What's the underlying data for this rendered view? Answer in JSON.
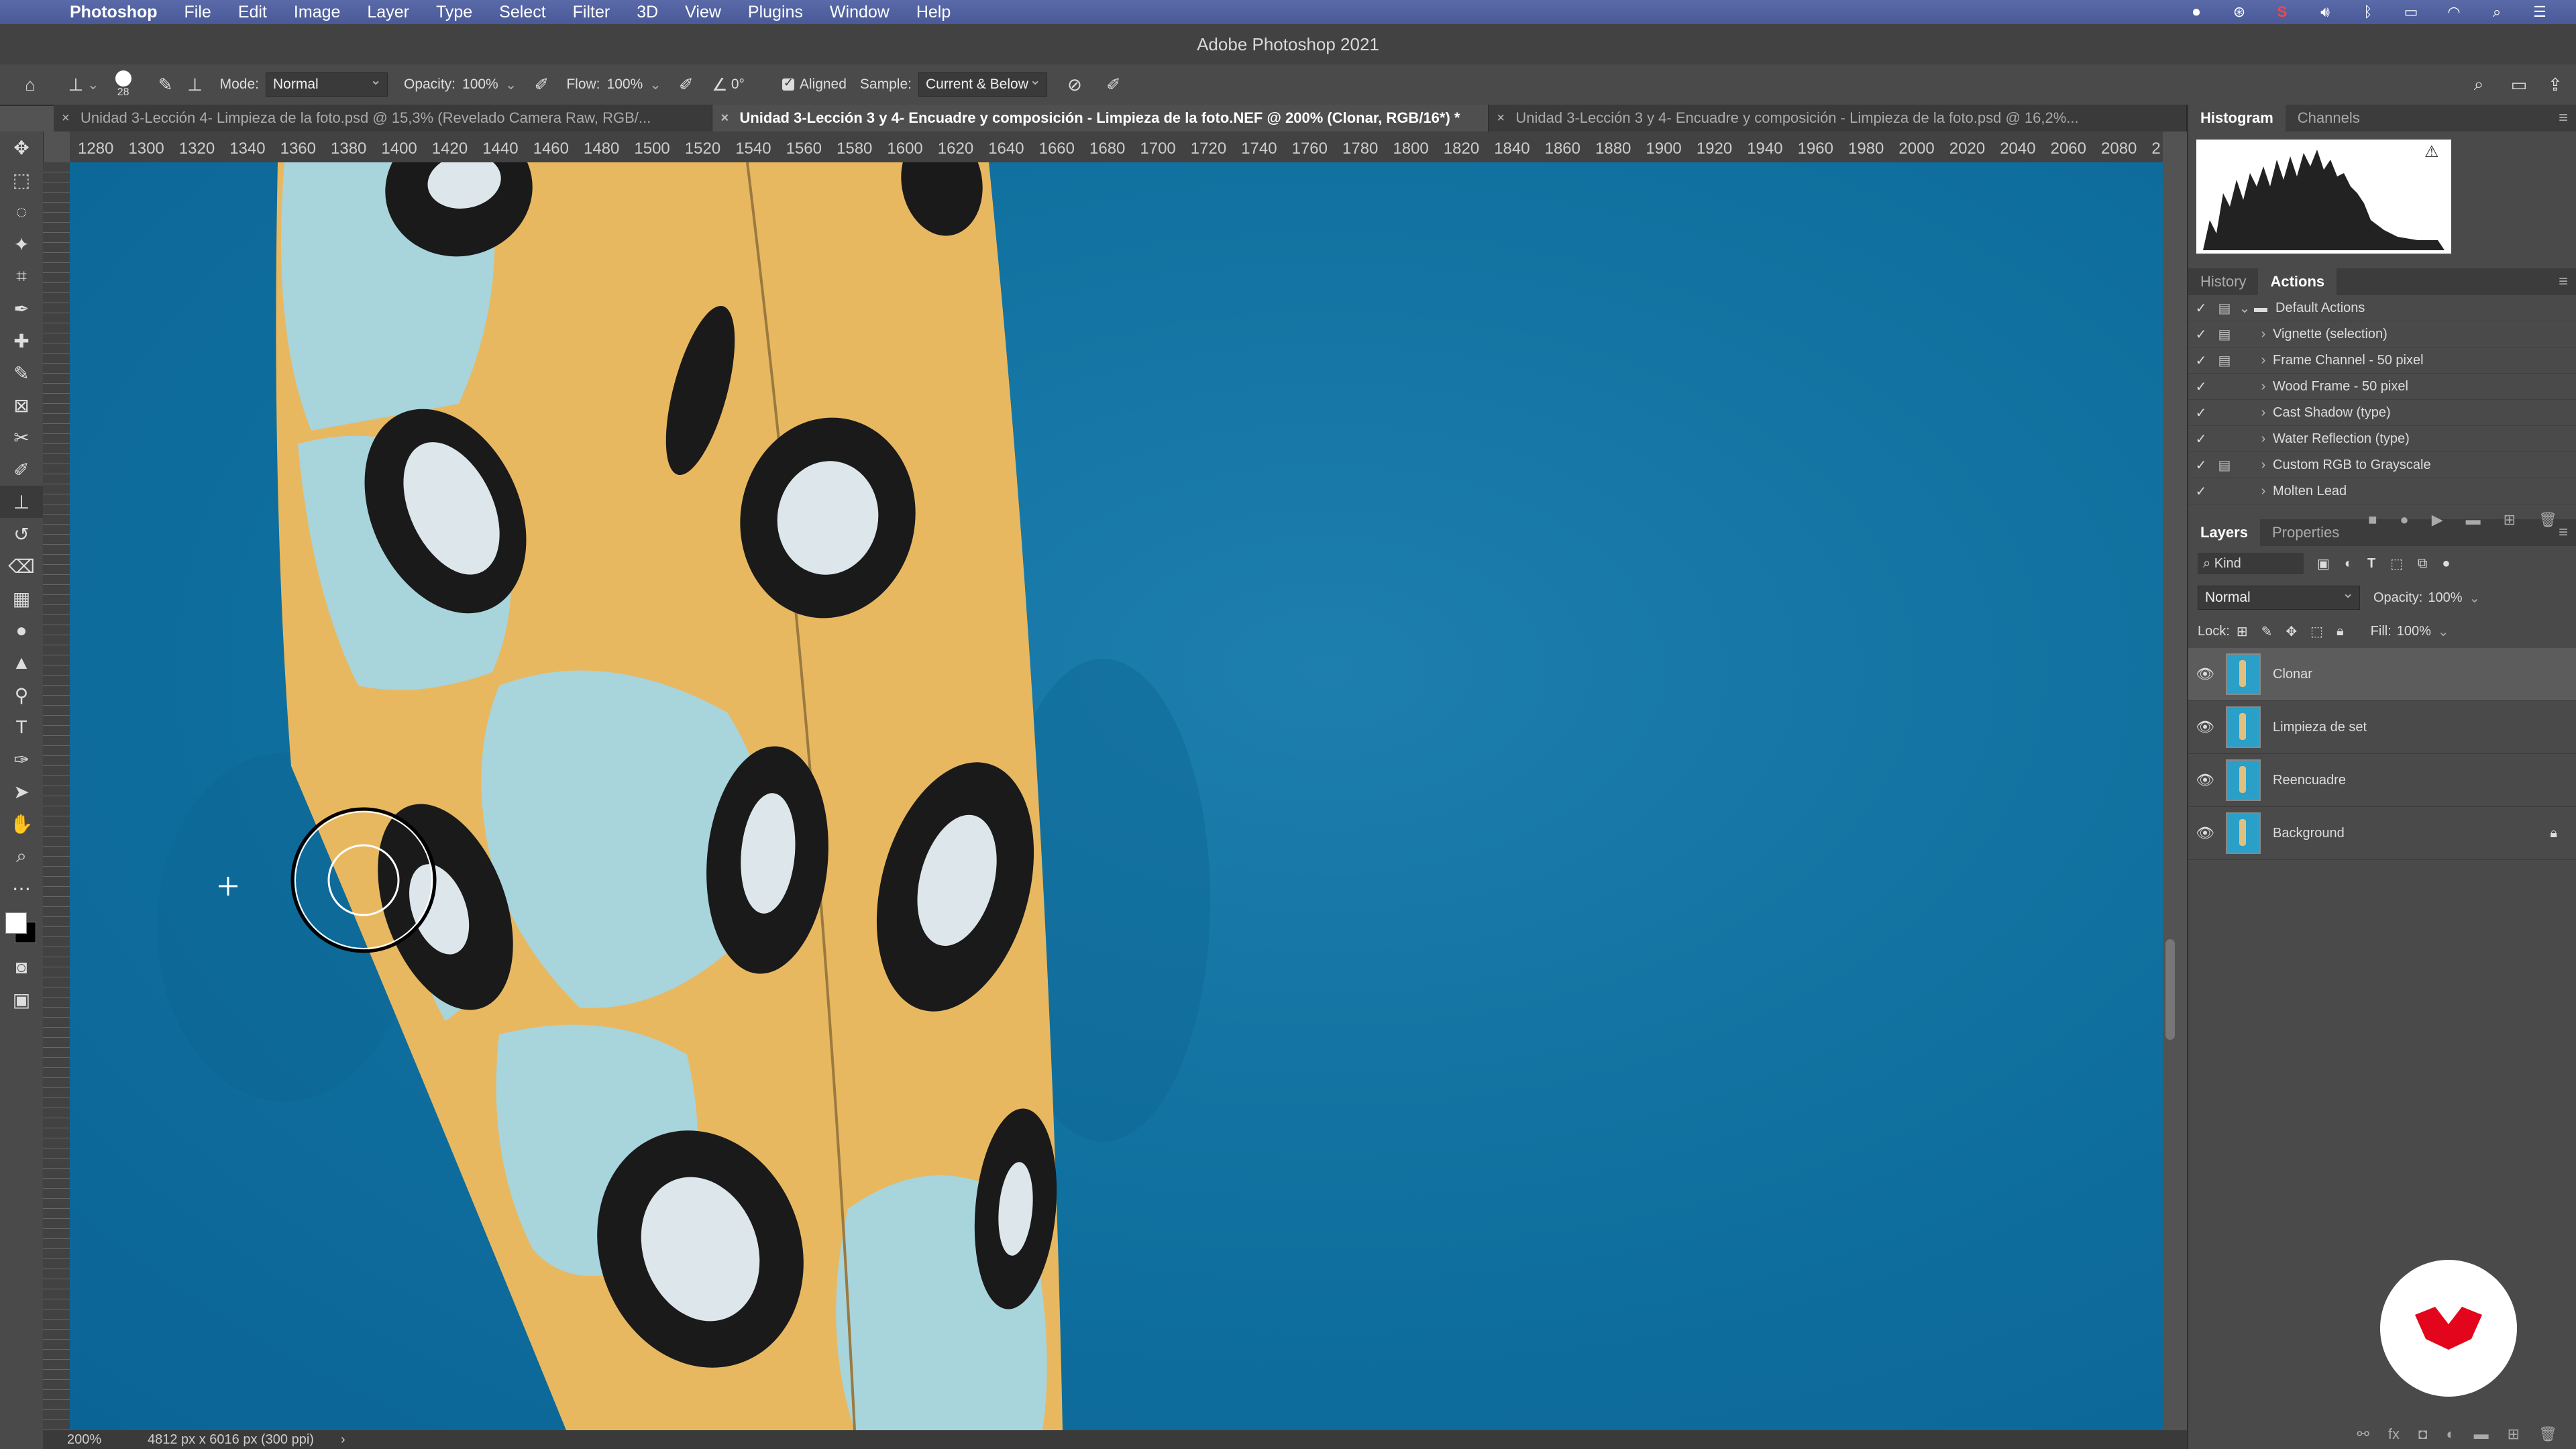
{
  "menubar": {
    "app": "Photoshop",
    "items": [
      "File",
      "Edit",
      "Image",
      "Layer",
      "Type",
      "Select",
      "Filter",
      "3D",
      "View",
      "Plugins",
      "Window",
      "Help"
    ]
  },
  "window_title": "Adobe Photoshop 2021",
  "options": {
    "brush_size": "28",
    "mode_label": "Mode:",
    "mode_value": "Normal",
    "opacity_label": "Opacity:",
    "opacity_value": "100%",
    "flow_label": "Flow:",
    "flow_value": "100%",
    "angle_value": "0°",
    "aligned_label": "Aligned",
    "sample_label": "Sample:",
    "sample_value": "Current & Below"
  },
  "tabs": [
    {
      "label": "Unidad 3-Lección 4- Limpieza de la foto.psd @ 15,3% (Revelado Camera Raw, RGB/...",
      "active": false
    },
    {
      "label": "Unidad 3-Lección 3 y 4- Encuadre y composición - Limpieza de la foto.NEF @ 200% (Clonar, RGB/16*) *",
      "active": true
    },
    {
      "label": "Unidad 3-Lección 3 y 4- Encuadre y composición - Limpieza de la foto.psd @ 16,2%...",
      "active": false
    }
  ],
  "ruler_ticks": [
    "1280",
    "1300",
    "1320",
    "1340",
    "1360",
    "1380",
    "1400",
    "1420",
    "1440",
    "1460",
    "1480",
    "1500",
    "1520",
    "1540",
    "1560",
    "1580",
    "1600",
    "1620",
    "1640",
    "1660",
    "1680",
    "1700",
    "1720",
    "1740",
    "1760",
    "1780",
    "1800",
    "1820",
    "1840",
    "1860",
    "1880",
    "1900",
    "1920",
    "1940",
    "1960",
    "1980",
    "2000",
    "2020",
    "2040",
    "2060",
    "2080",
    "2"
  ],
  "status": {
    "zoom": "200%",
    "doc_info": "4812 px x 6016 px (300 ppi)"
  },
  "histogram_panel": {
    "tabs": [
      "Histogram",
      "Channels"
    ]
  },
  "actions_panel": {
    "tabs": [
      "History",
      "Actions"
    ],
    "items": [
      {
        "label": "Default Actions",
        "folder": true
      },
      {
        "label": "Vignette (selection)"
      },
      {
        "label": "Frame Channel - 50 pixel"
      },
      {
        "label": "Wood Frame - 50 pixel"
      },
      {
        "label": "Cast Shadow (type)"
      },
      {
        "label": "Water Reflection (type)"
      },
      {
        "label": "Custom RGB to Grayscale"
      },
      {
        "label": "Molten Lead"
      }
    ]
  },
  "layers_panel": {
    "tabs": [
      "Layers",
      "Properties"
    ],
    "filter_label": "Kind",
    "blend_mode": "Normal",
    "opacity_label": "Opacity:",
    "opacity_value": "100%",
    "lock_label": "Lock:",
    "fill_label": "Fill:",
    "fill_value": "100%",
    "layers": [
      {
        "name": "Clonar",
        "selected": true
      },
      {
        "name": "Limpieza de set"
      },
      {
        "name": "Reencuadre"
      },
      {
        "name": "Background",
        "locked": true
      }
    ]
  },
  "colors": {
    "canvas_blue": "#0f6f9e",
    "tube_yellow": "#e8b860",
    "spot_light_blue": "#a8d4dc",
    "logo_red": "#e3051b"
  }
}
